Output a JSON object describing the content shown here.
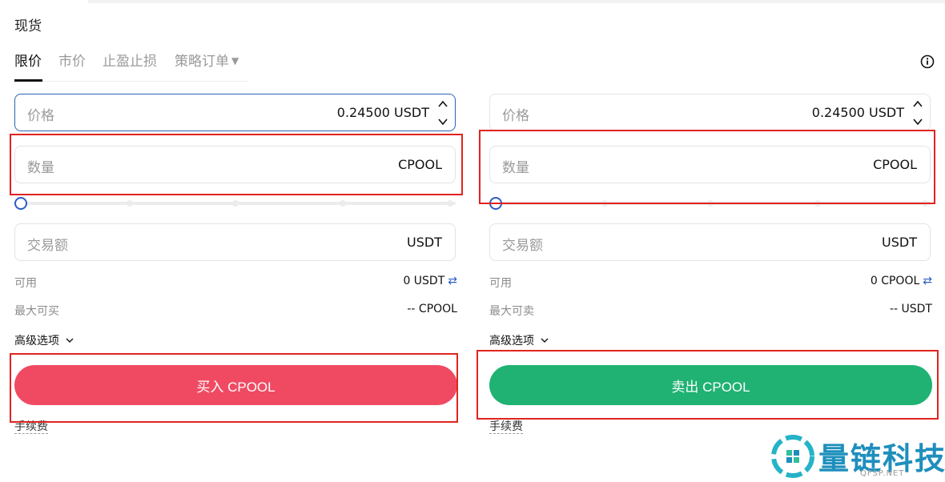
{
  "section_title": "现货",
  "tabs": [
    {
      "label": "限价",
      "active": true
    },
    {
      "label": "市价",
      "active": false
    },
    {
      "label": "止盈止损",
      "active": false
    },
    {
      "label": "策略订单",
      "active": false
    }
  ],
  "icons": {
    "info": "info-circle-icon",
    "swap": "swap-arrows-icon",
    "stepper": "chevron-up-down-icon",
    "dropdown": "chevron-down-icon"
  },
  "colors": {
    "buy": "#f04a63",
    "sell": "#1fb273",
    "accent": "#2b5cc4",
    "highlight": "#e0241f"
  },
  "buy": {
    "price": {
      "label": "价格",
      "value": "0.24500 USDT"
    },
    "amount": {
      "label": "数量",
      "value": "CPOOL"
    },
    "slider_value_percent": 0,
    "total": {
      "label": "交易额",
      "value": "USDT"
    },
    "available": {
      "label": "可用",
      "value": "0 USDT"
    },
    "swap_symbol": "⇄",
    "max": {
      "label": "最大可买",
      "value": "-- CPOOL"
    },
    "advanced": "高级选项",
    "action": "买入 CPOOL",
    "fee": "手续费"
  },
  "sell": {
    "price": {
      "label": "价格",
      "value": "0.24500 USDT"
    },
    "amount": {
      "label": "数量",
      "value": "CPOOL"
    },
    "slider_value_percent": 0,
    "total": {
      "label": "交易额",
      "value": "USDT"
    },
    "available": {
      "label": "可用",
      "value": "0 CPOOL"
    },
    "swap_symbol": "⇄",
    "max": {
      "label": "最大可卖",
      "value": "-- USDT"
    },
    "advanced": "高级选项",
    "action": "卖出 CPOOL",
    "fee": "手续费"
  },
  "watermark": {
    "title": "量链科技",
    "site": "QFSP.NET"
  }
}
